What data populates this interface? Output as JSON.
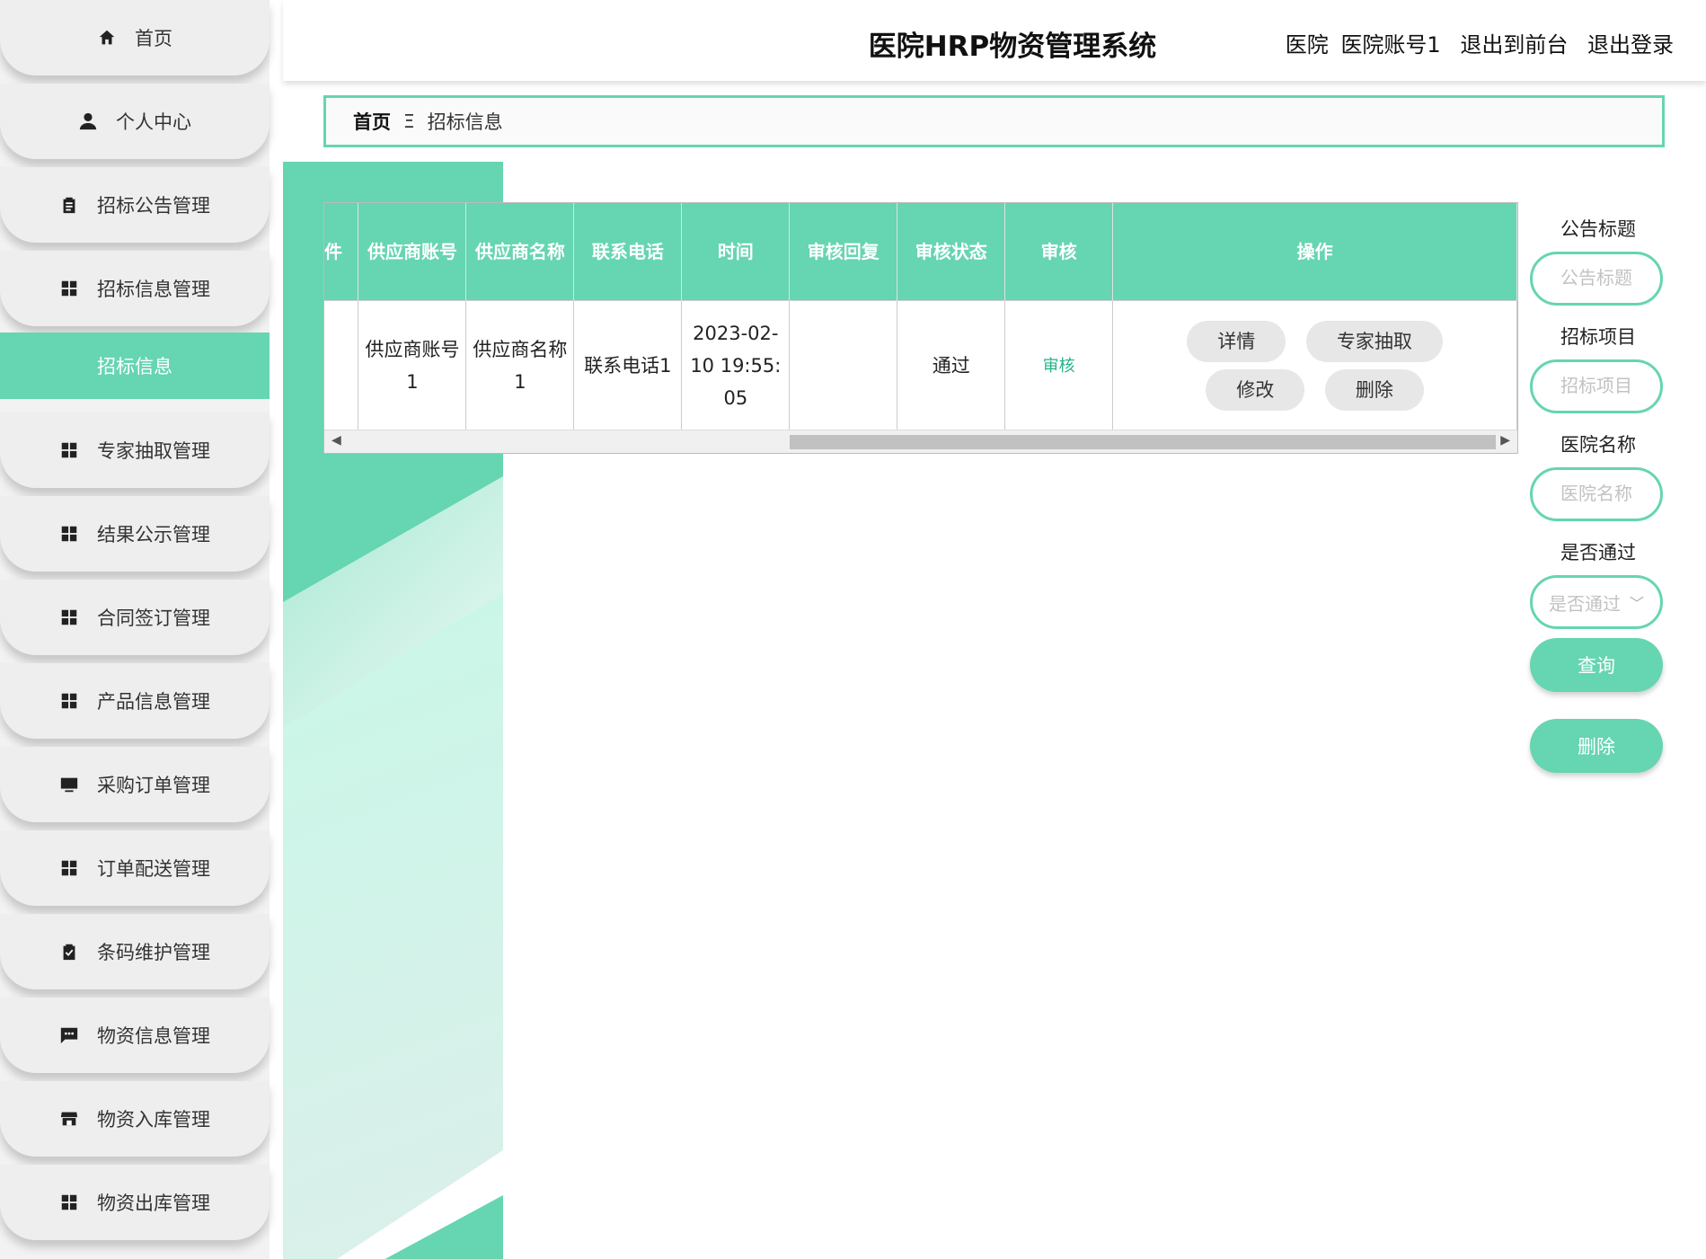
{
  "header": {
    "title": "医院HRP物资管理系统",
    "user_role": "医院",
    "user_account": "医院账号1",
    "exit_front": "退出到前台",
    "logout": "退出登录"
  },
  "sidebar": {
    "items": [
      {
        "label": "首页",
        "icon": "home-icon"
      },
      {
        "label": "个人中心",
        "icon": "user-icon"
      },
      {
        "label": "招标公告管理",
        "icon": "clipboard-icon"
      },
      {
        "label": "招标信息管理",
        "icon": "grid-icon"
      },
      {
        "label": "招标信息",
        "icon": "",
        "active": true
      },
      {
        "label": "专家抽取管理",
        "icon": "grid-icon"
      },
      {
        "label": "结果公示管理",
        "icon": "grid-icon"
      },
      {
        "label": "合同签订管理",
        "icon": "grid-icon"
      },
      {
        "label": "产品信息管理",
        "icon": "grid-icon"
      },
      {
        "label": "采购订单管理",
        "icon": "monitor-icon"
      },
      {
        "label": "订单配送管理",
        "icon": "grid-icon"
      },
      {
        "label": "条码维护管理",
        "icon": "clipboard-check-icon"
      },
      {
        "label": "物资信息管理",
        "icon": "chat-icon"
      },
      {
        "label": "物资入库管理",
        "icon": "store-icon"
      },
      {
        "label": "物资出库管理",
        "icon": "grid-icon"
      }
    ]
  },
  "breadcrumb": {
    "home": "首页",
    "separator": "Ξ",
    "current": "招标信息"
  },
  "table": {
    "columns": [
      "件",
      "供应商账号",
      "供应商名称",
      "联系电话",
      "时间",
      "审核回复",
      "审核状态",
      "审核",
      "操作"
    ],
    "rows": [
      {
        "file": "",
        "supplier_account": "供应商账号1",
        "supplier_name": "供应商名称1",
        "phone": "联系电话1",
        "time": "2023-02-10 19:55:05",
        "reply": "",
        "status": "通过",
        "audit": "审核",
        "actions": [
          "详情",
          "专家抽取",
          "修改",
          "删除"
        ]
      }
    ]
  },
  "search": {
    "title_label": "公告标题",
    "title_placeholder": "公告标题",
    "project_label": "招标项目",
    "project_placeholder": "招标项目",
    "hospital_label": "医院名称",
    "hospital_placeholder": "医院名称",
    "pass_label": "是否通过",
    "pass_placeholder": "是否通过",
    "query_button": "查询",
    "delete_button": "删除"
  },
  "colors": {
    "accent": "#66d5b1",
    "audit_link": "#26b28a"
  }
}
